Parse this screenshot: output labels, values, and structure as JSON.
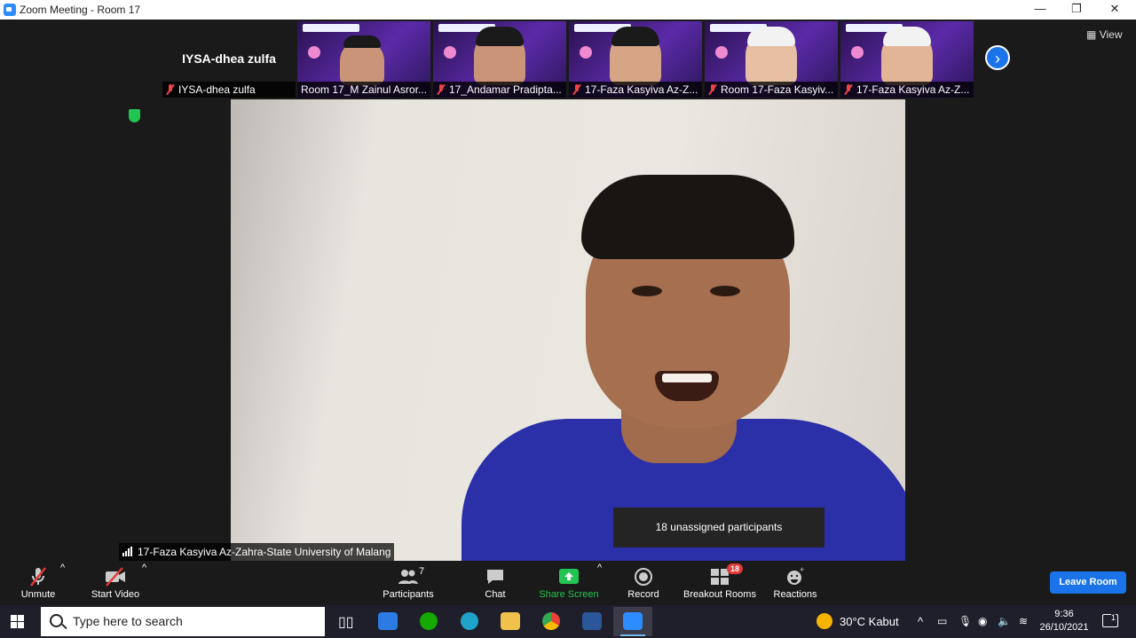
{
  "window": {
    "title": "Zoom Meeting - Room 17"
  },
  "gallery": {
    "first_tile_name": "IYSA-dhea zulfa",
    "tiles": [
      {
        "label": "IYSA-dhea zulfa"
      },
      {
        "label": "Room 17_M Zainul Asror..."
      },
      {
        "label": "17_Andamar Pradipta..."
      },
      {
        "label": "17-Faza Kasyiva Az-Z..."
      },
      {
        "label": "Room 17-Faza Kasyiv..."
      },
      {
        "label": "17-Faza Kasyiva Az-Z..."
      }
    ],
    "view_label": "View"
  },
  "active_speaker": {
    "label": "17-Faza Kasyiva Az-Zahra-State University of Malang"
  },
  "tooltip": {
    "text": "18 unassigned participants"
  },
  "toolbar": {
    "unmute": "Unmute",
    "start_video": "Start Video",
    "participants": "Participants",
    "participants_count": "7",
    "chat": "Chat",
    "share_screen": "Share Screen",
    "record": "Record",
    "breakout_rooms": "Breakout Rooms",
    "breakout_badge": "18",
    "reactions": "Reactions",
    "leave": "Leave Room"
  },
  "taskbar": {
    "search_placeholder": "Type here to search",
    "weather": "30°C  Kabut",
    "time": "9:36",
    "date": "26/10/2021",
    "notifications": "1"
  }
}
